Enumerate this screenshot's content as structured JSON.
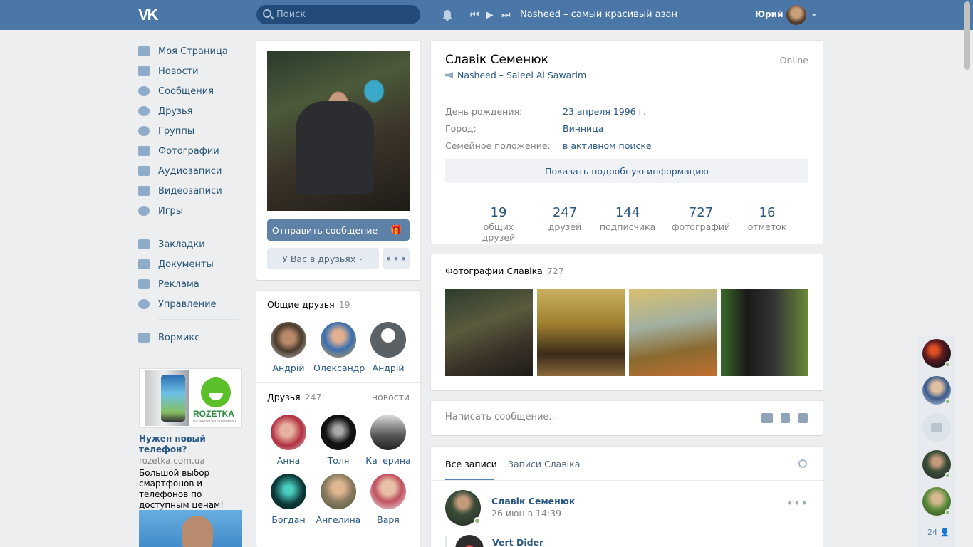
{
  "header": {
    "search_placeholder": "Поиск",
    "now_playing": "Nasheed – самый красивый азан",
    "user_name": "Юрий"
  },
  "nav": {
    "items": [
      "Моя Страница",
      "Новости",
      "Сообщения",
      "Друзья",
      "Группы",
      "Фотографии",
      "Аудиозаписи",
      "Видеозаписи",
      "Игры"
    ],
    "items2": [
      "Закладки",
      "Документы",
      "Реклама",
      "Управление"
    ],
    "items3": [
      "Вормикс"
    ]
  },
  "ad": {
    "brand": "ROZETKA",
    "brand_sub": "интернет-супермаркет",
    "title": "Нужен новый телефон?",
    "domain": "rozetka.com.ua",
    "text": "Большой выбор смартфонов и телефонов по доступным ценам!"
  },
  "profile_actions": {
    "send_message": "Отправить сообщение",
    "in_friends": "У Вас в друзьях"
  },
  "mutual": {
    "title": "Общие друзья",
    "count": "19",
    "friends": [
      "Андрій",
      "Олександр",
      "Андрій"
    ]
  },
  "friends": {
    "title": "Друзья",
    "count": "247",
    "news_link": "новости",
    "list": [
      "Анна",
      "Толя",
      "Катерина",
      "Богдан",
      "Ангелина",
      "Варя"
    ]
  },
  "profile": {
    "name": "Славік Семенюк",
    "online": "Online",
    "status": "Nasheed – Saleel Al Sawarim",
    "info": [
      {
        "label": "День рождения:",
        "value": "23 апреля 1996 г."
      },
      {
        "label": "Город:",
        "value": "Винница"
      },
      {
        "label": "Семейное положение:",
        "value": "в активном поиске"
      }
    ],
    "show_more": "Показать подробную информацию",
    "counters": [
      {
        "value": "19",
        "label": "общих друзей"
      },
      {
        "value": "247",
        "label": "друзей"
      },
      {
        "value": "144",
        "label": "подписчика"
      },
      {
        "value": "727",
        "label": "фотографий"
      },
      {
        "value": "16",
        "label": "отметок"
      }
    ]
  },
  "photos": {
    "title": "Фотографии Славіка",
    "count": "727"
  },
  "write": {
    "placeholder": "Написать сообщение.."
  },
  "wall": {
    "tab_all": "Все записи",
    "tab_own": "Записи Славіка",
    "post_author": "Славік Семенюк",
    "post_date": "26 июн в 14:39",
    "repost_author": "Vert Dider"
  },
  "friends_bar": {
    "count": "24"
  }
}
